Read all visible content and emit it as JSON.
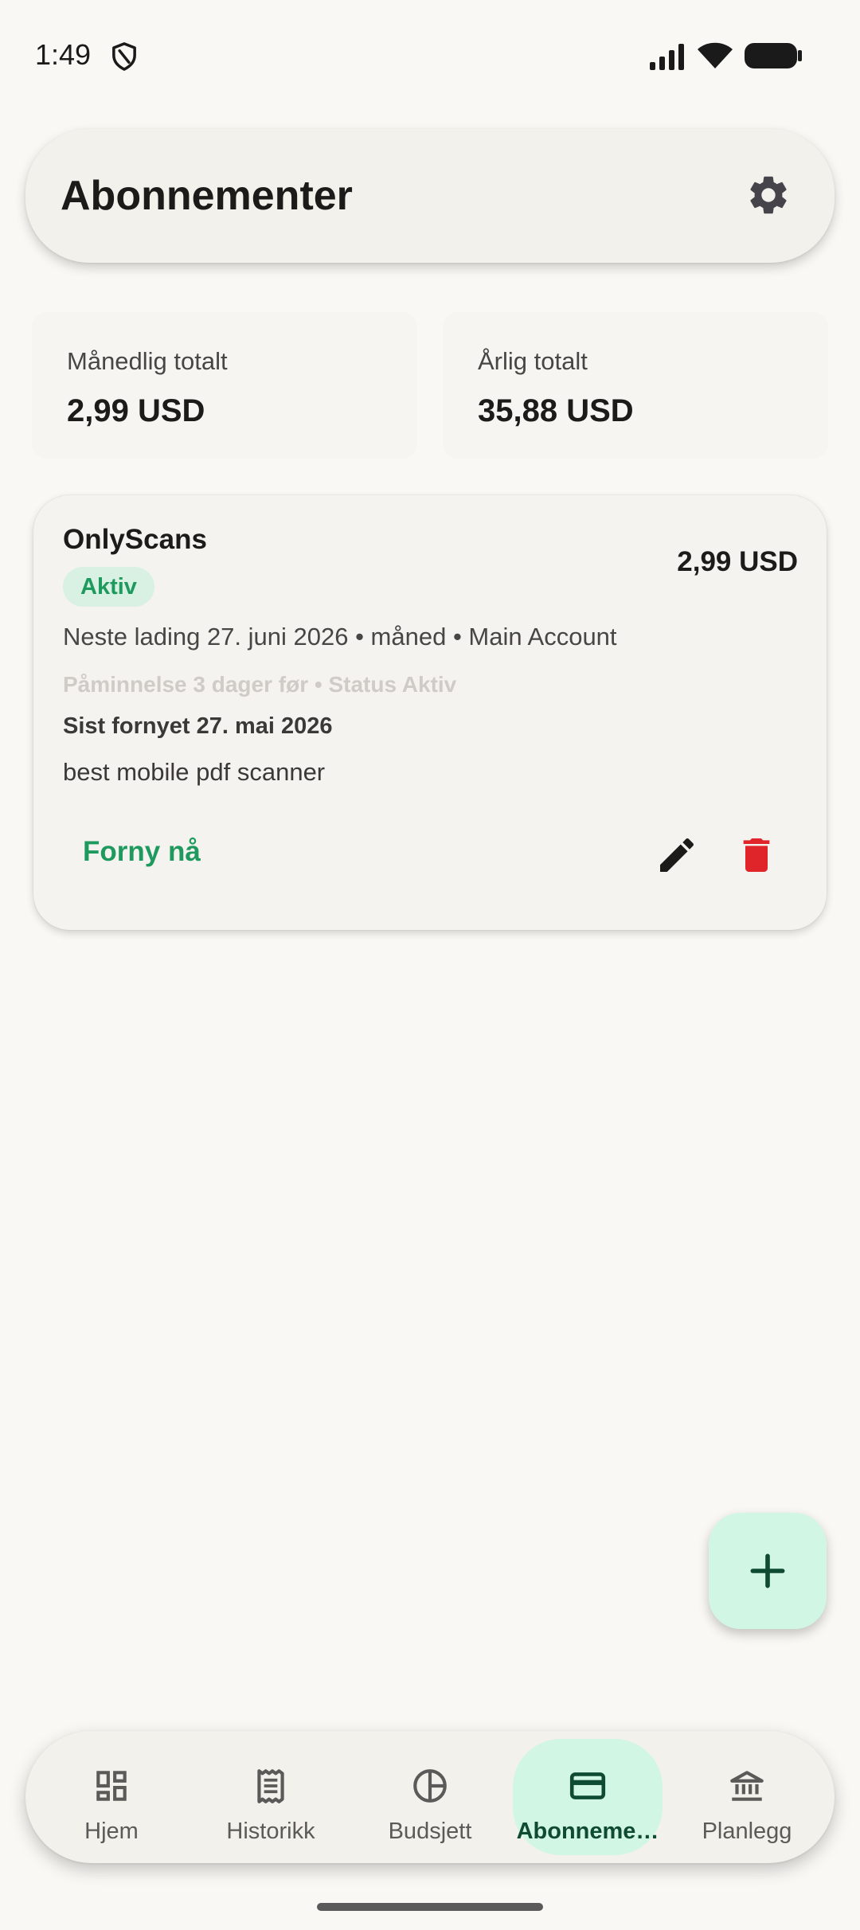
{
  "status_bar": {
    "time": "1:49",
    "icons": [
      "shield-icon",
      "signal-icon",
      "wifi-icon",
      "battery-icon"
    ]
  },
  "app_bar": {
    "title": "Abonnementer",
    "settings_icon": "gear-icon"
  },
  "totals": {
    "monthly_label": "Månedlig totalt",
    "monthly_value": "2,99 USD",
    "yearly_label": "Årlig totalt",
    "yearly_value": "35,88 USD"
  },
  "subscriptions": [
    {
      "name": "OnlyScans",
      "price": "2,99 USD",
      "status": "Aktiv",
      "next_charge": "Neste lading 27. juni 2026 • måned • Main Account",
      "reminder": "Påminnelse 3 dager før • Status Aktiv",
      "last_renewed": "Sist fornyet 27. mai 2026",
      "note": "best mobile pdf scanner",
      "renew_label": "Forny nå"
    }
  ],
  "fab": {
    "icon": "plus-icon"
  },
  "bottom_nav": {
    "items": [
      {
        "label": "Hjem",
        "icon": "dashboard-icon"
      },
      {
        "label": "Historikk",
        "icon": "receipt-icon"
      },
      {
        "label": "Budsjett",
        "icon": "pie-chart-icon"
      },
      {
        "label": "Abonneme…",
        "icon": "credit-card-icon",
        "active": true
      },
      {
        "label": "Planlegg",
        "icon": "bank-icon"
      }
    ]
  },
  "colors": {
    "background": "#faf8f4",
    "accent_green": "#1f9a5e",
    "active_pill": "#d2f6e4",
    "delete_red": "#e0252a"
  }
}
